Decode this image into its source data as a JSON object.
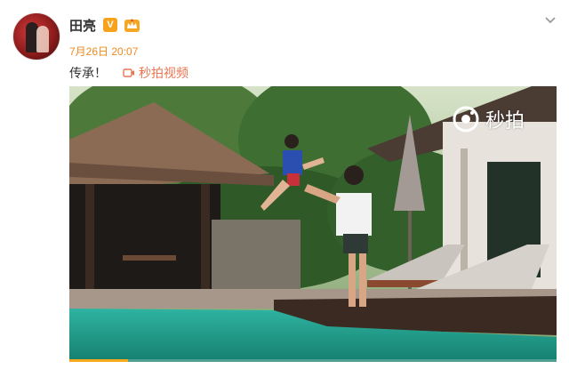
{
  "post": {
    "username": "田亮",
    "verified_badge": "V",
    "timestamp": "7月26日 20:07",
    "text": "传承！",
    "video_link_label": "秒拍视频"
  },
  "video": {
    "watermark_text": "秒拍",
    "progress_fraction": 0.12
  },
  "icons": {
    "verified": "verified-v-icon",
    "member": "member-crown-icon",
    "menu": "chevron-down-icon",
    "video_link": "video-camera-icon",
    "watermark_logo": "miaopai-logo-icon"
  },
  "colors": {
    "timestamp": "#f08a1f",
    "link": "#eb7350",
    "verified": "#f7a21b",
    "progress": "#f8a81d"
  }
}
